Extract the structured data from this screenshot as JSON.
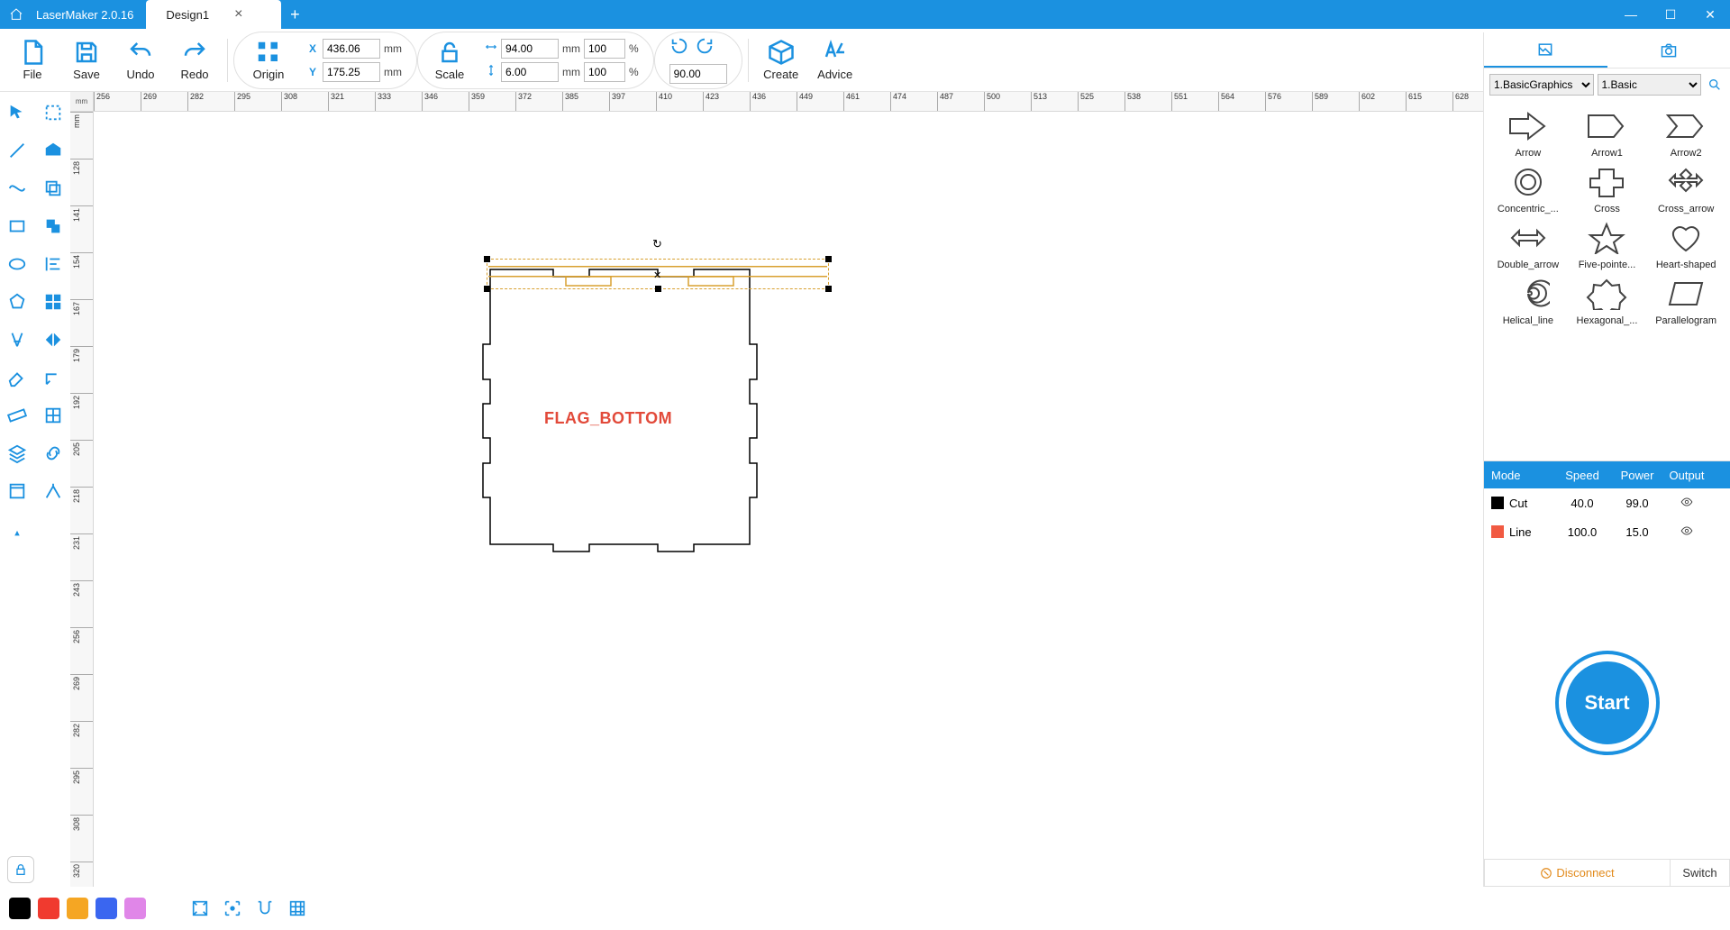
{
  "app": {
    "name": "LaserMaker 2.0.16",
    "tab_title": "Design1"
  },
  "toolbar": {
    "file": "File",
    "save": "Save",
    "undo": "Undo",
    "redo": "Redo",
    "origin": "Origin",
    "scale": "Scale",
    "create": "Create",
    "advice": "Advice",
    "x_label": "X",
    "y_label": "Y",
    "x_value": "436.06",
    "y_value": "175.25",
    "w_value": "94.00",
    "h_value": "6.00",
    "pct_w": "100",
    "pct_h": "100",
    "rot_value": "90.00",
    "mm": "mm",
    "pct": "%"
  },
  "ruler": {
    "unit_label": "mm",
    "h_ticks": [
      "256",
      "269",
      "282",
      "295",
      "308",
      "321",
      "333",
      "346",
      "359",
      "372",
      "385",
      "397",
      "410",
      "423",
      "436",
      "449",
      "461",
      "474",
      "487",
      "500",
      "513",
      "525",
      "538",
      "551",
      "564",
      "576",
      "589",
      "602",
      "615",
      "628"
    ],
    "v_ticks": [
      "mm",
      "128",
      "141",
      "154",
      "167",
      "179",
      "192",
      "205",
      "218",
      "231",
      "243",
      "256",
      "269",
      "282",
      "295",
      "308",
      "320"
    ]
  },
  "canvas": {
    "label_text": "FLAG_BOTTOM"
  },
  "right": {
    "filter1": "1.BasicGraphics",
    "filter2": "1.Basic",
    "shapes": [
      "Arrow",
      "Arrow1",
      "Arrow2",
      "Concentric_...",
      "Cross",
      "Cross_arrow",
      "Double_arrow",
      "Five-pointe...",
      "Heart-shaped",
      "Helical_line",
      "Hexagonal_...",
      "Parallelogram"
    ],
    "headers": {
      "mode": "Mode",
      "speed": "Speed",
      "power": "Power",
      "output": "Output"
    },
    "layers": [
      {
        "color": "#000000",
        "mode": "Cut",
        "speed": "40.0",
        "power": "99.0"
      },
      {
        "color": "#f15a42",
        "mode": "Line",
        "speed": "100.0",
        "power": "15.0"
      }
    ],
    "start": "Start",
    "disconnect": "Disconnect",
    "switch": "Switch"
  },
  "bottom": {
    "swatches": [
      "#000000",
      "#f03a2f",
      "#f5a623",
      "#3a66f0",
      "#e086e8"
    ]
  }
}
